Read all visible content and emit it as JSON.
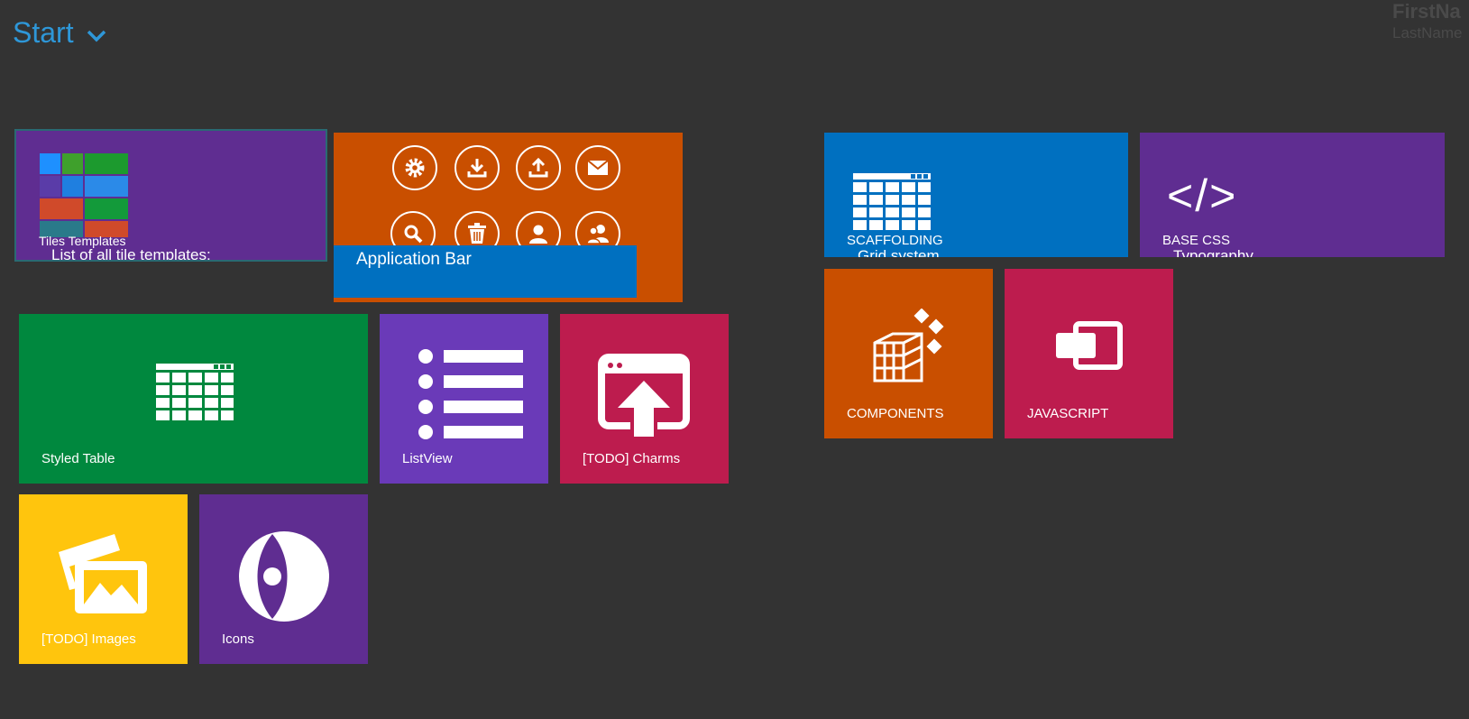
{
  "header": {
    "title": "Start",
    "user_first": "FirstNa",
    "user_last": "LastName"
  },
  "tiles": {
    "tiles_templates": {
      "label": "Tiles Templates",
      "sub": "List of all tile templates:",
      "color": "#5f2d91"
    },
    "application_bar": {
      "label": "Application Bar",
      "color": "#c94f00"
    },
    "scaffolding": {
      "label": "SCAFFOLDING",
      "sub": "Grid system",
      "color": "#0070c0"
    },
    "base_css": {
      "label": "BASE CSS",
      "sub": "Typography",
      "color": "#5f2d91"
    },
    "styled_table": {
      "label": "Styled Table",
      "color": "#00883e"
    },
    "listview": {
      "label": "ListView",
      "color": "#6a3ab8"
    },
    "charms": {
      "label": "[TODO] Charms",
      "color": "#bd1c4e"
    },
    "components": {
      "label": "COMPONENTS",
      "color": "#c94f00"
    },
    "javascript": {
      "label": "JAVASCRIPT",
      "color": "#bd1c4e"
    },
    "images": {
      "label": "[TODO] Images",
      "color": "#ffc50d"
    },
    "icons": {
      "label": "Icons",
      "color": "#5f2d91"
    }
  },
  "code_glyph": "</>",
  "appbar_icons": [
    "gear-icon",
    "download-icon",
    "upload-icon",
    "mail-icon",
    "search-icon",
    "trash-icon",
    "user-icon",
    "users-icon"
  ]
}
